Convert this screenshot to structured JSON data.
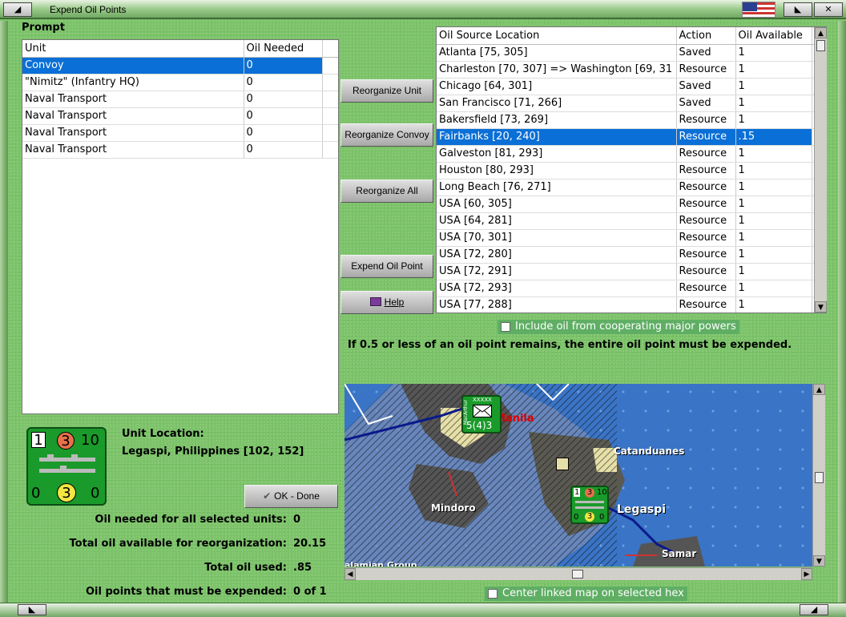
{
  "window": {
    "title": "Expend Oil Points"
  },
  "prompt_label": "Prompt",
  "units_table": {
    "headers": [
      "Unit",
      "Oil Needed"
    ],
    "rows": [
      {
        "unit": "Convoy",
        "oil": "0"
      },
      {
        "unit": "\"Nimitz\" (Infantry HQ)",
        "oil": "0"
      },
      {
        "unit": "Naval Transport",
        "oil": "0"
      },
      {
        "unit": "Naval Transport",
        "oil": "0"
      },
      {
        "unit": "Naval Transport",
        "oil": "0"
      },
      {
        "unit": "Naval Transport",
        "oil": "0"
      }
    ]
  },
  "buttons": {
    "reorganize_unit": "Reorganize Unit",
    "reorganize_convoy": "Reorganize Convoy",
    "reorganize_all": "Reorganize All",
    "expend_oil_point": "Expend Oil Point",
    "help": "Help",
    "ok_done": "OK - Done"
  },
  "sources_table": {
    "headers": [
      "Oil Source Location",
      "Action",
      "Oil Available"
    ],
    "rows": [
      {
        "loc": "Atlanta [75, 305]",
        "action": "Saved",
        "avail": "1"
      },
      {
        "loc": "Charleston [70, 307] => Washington [69, 31",
        "action": "Resource",
        "avail": "1"
      },
      {
        "loc": "Chicago [64, 301]",
        "action": "Saved",
        "avail": "1"
      },
      {
        "loc": "San Francisco [71, 266]",
        "action": "Saved",
        "avail": "1"
      },
      {
        "loc": "Bakersfield [73, 269]",
        "action": "Resource",
        "avail": "1"
      },
      {
        "loc": "Fairbanks [20, 240]",
        "action": "Resource",
        "avail": ".15"
      },
      {
        "loc": "Galveston [81, 293]",
        "action": "Resource",
        "avail": "1"
      },
      {
        "loc": "Houston [80, 293]",
        "action": "Resource",
        "avail": "1"
      },
      {
        "loc": "Long Beach [76, 271]",
        "action": "Resource",
        "avail": "1"
      },
      {
        "loc": "USA [60, 305]",
        "action": "Resource",
        "avail": "1"
      },
      {
        "loc": "USA [64, 281]",
        "action": "Resource",
        "avail": "1"
      },
      {
        "loc": "USA [70, 301]",
        "action": "Resource",
        "avail": "1"
      },
      {
        "loc": "USA [72, 280]",
        "action": "Resource",
        "avail": "1"
      },
      {
        "loc": "USA [72, 291]",
        "action": "Resource",
        "avail": "1"
      },
      {
        "loc": "USA [72, 293]",
        "action": "Resource",
        "avail": "1"
      },
      {
        "loc": "USA [77, 288]",
        "action": "Resource",
        "avail": "1"
      }
    ]
  },
  "include_coop": {
    "label": "Include oil from cooperating major powers",
    "checked": false
  },
  "rule_text": "If 0.5 or less of an oil point remains, the entire oil point must be expended.",
  "unit_location": {
    "label": "Unit Location:",
    "value": "Legaspi, Philippines [102, 152]"
  },
  "counter": {
    "top_left": "1",
    "top_mid": "3",
    "top_right": "10",
    "bot_left": "0",
    "bot_mid": "3",
    "bot_right": "0"
  },
  "stats": [
    {
      "label": "Oil needed for all selected units:",
      "value": "0"
    },
    {
      "label": "Total oil available for reorganization:",
      "value": "20.15"
    },
    {
      "label": "Total oil used:",
      "value": ".85"
    },
    {
      "label": "Oil points that must be expended:",
      "value": "0 of 1"
    }
  ],
  "map": {
    "labels": [
      "Manila",
      "Catanduanes",
      "Mindoro",
      "Legaspi",
      "Samar",
      "alamian Group"
    ],
    "hq_counter": {
      "top": "XXXXX",
      "side": "MacArthur",
      "value": "5(4)3"
    },
    "naval_counter": {
      "a": "1",
      "b": "3",
      "c": "10",
      "d": "0",
      "e": "3",
      "f": "0"
    }
  },
  "center_map": {
    "label": "Center linked map on selected hex",
    "checked": false
  }
}
